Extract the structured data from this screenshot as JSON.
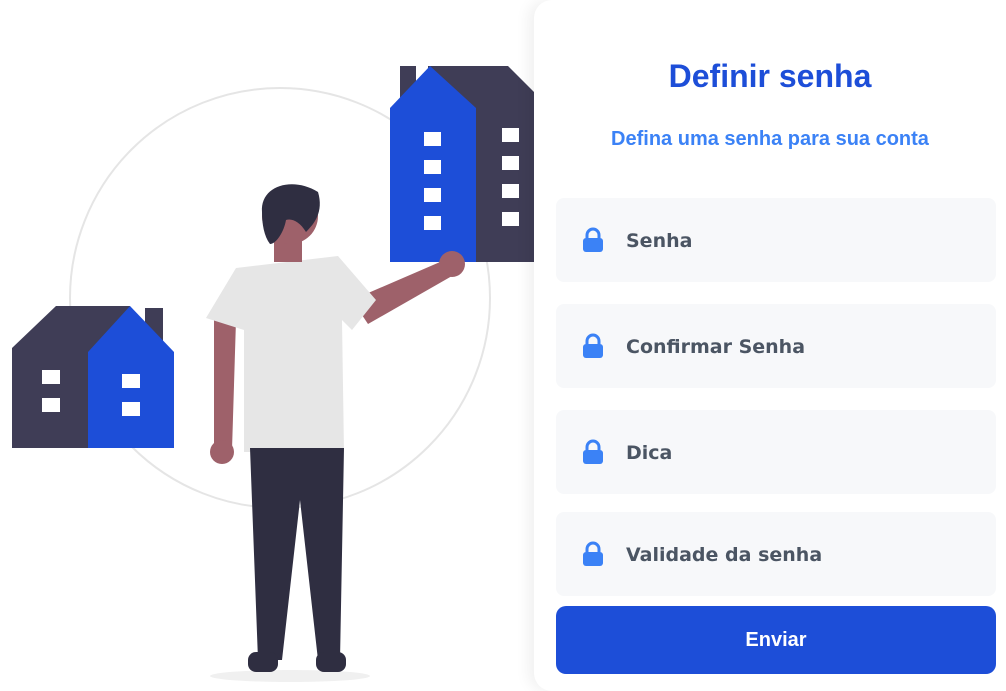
{
  "illustration": {
    "description_icon": "person-with-houses-illustration"
  },
  "form": {
    "title": "Definir senha",
    "subtitle": "Defina uma senha para sua conta",
    "fields": [
      {
        "placeholder": "Senha",
        "icon": "lock-icon",
        "value": ""
      },
      {
        "placeholder": "Confirmar Senha",
        "icon": "lock-icon",
        "value": ""
      },
      {
        "placeholder": "Dica",
        "icon": "lock-icon",
        "value": ""
      },
      {
        "placeholder": "Validade da senha",
        "icon": "lock-icon",
        "value": ""
      }
    ],
    "submit_label": "Enviar"
  },
  "colors": {
    "primary": "#1d4ed8",
    "accent": "#3b82f6",
    "house_dark": "#3f3d56",
    "field_bg": "#f7f8fa"
  }
}
